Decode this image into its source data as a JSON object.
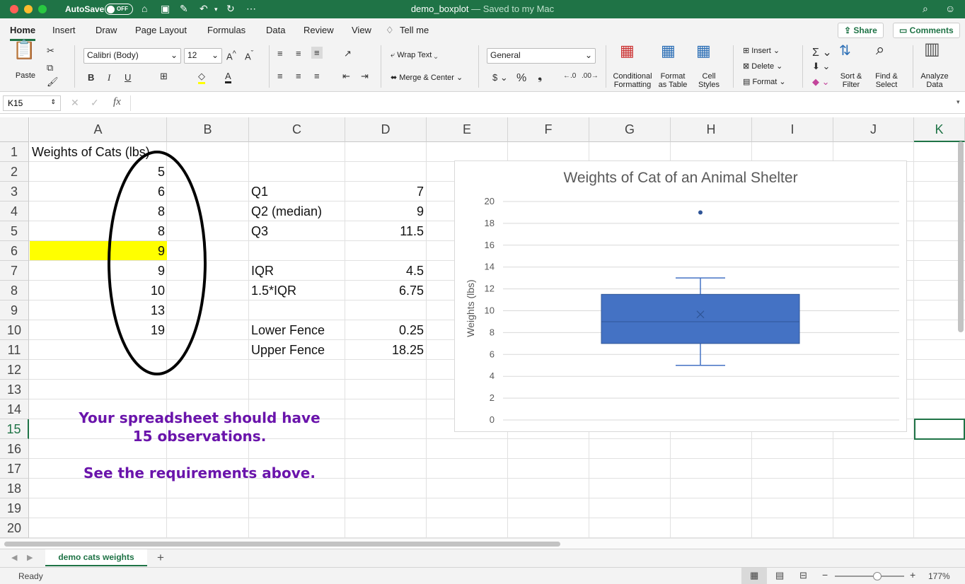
{
  "window": {
    "autosave_label": "AutoSave",
    "autosave_state": "OFF",
    "doc_title": "demo_boxplot",
    "doc_subtitle": "— Saved to my Mac"
  },
  "ribbon_tabs": [
    "Home",
    "Insert",
    "Draw",
    "Page Layout",
    "Formulas",
    "Data",
    "Review",
    "View",
    "Tell me"
  ],
  "header_buttons": {
    "share": "Share",
    "comments": "Comments"
  },
  "ribbon": {
    "paste": "Paste",
    "font_name": "Calibri (Body)",
    "font_size": "12",
    "bold": "B",
    "italic": "I",
    "underline": "U",
    "wrap_text": "Wrap Text",
    "merge_center": "Merge & Center",
    "number_format": "General",
    "conditional_formatting": [
      "Conditional",
      "Formatting"
    ],
    "format_as_table": [
      "Format",
      "as Table"
    ],
    "cell_styles": [
      "Cell",
      "Styles"
    ],
    "insert": "Insert",
    "delete": "Delete",
    "format": "Format",
    "sort_filter": [
      "Sort &",
      "Filter"
    ],
    "find_select": [
      "Find &",
      "Select"
    ],
    "analyze_data": [
      "Analyze",
      "Data"
    ]
  },
  "formula_bar": {
    "name_box": "K15",
    "fx": "fx",
    "formula": ""
  },
  "columns": [
    "A",
    "B",
    "C",
    "D",
    "E",
    "F",
    "G",
    "H",
    "I",
    "J",
    "K"
  ],
  "rows": [
    "1",
    "2",
    "3",
    "4",
    "5",
    "6",
    "7",
    "8",
    "9",
    "10",
    "11",
    "12",
    "13",
    "14",
    "15",
    "16",
    "17",
    "18",
    "19",
    "20"
  ],
  "cells": {
    "A1": "Weights of Cats (lbs)",
    "A2": "5",
    "A3": "6",
    "A4": "8",
    "A5": "8",
    "A6": "9",
    "A7": "9",
    "A8": "10",
    "A9": "13",
    "A10": "19",
    "C3": "Q1",
    "D3": "7",
    "C4": "Q2 (median)",
    "D4": "9",
    "C5": "Q3",
    "D5": "11.5",
    "C7": "IQR",
    "D7": "4.5",
    "C8": "1.5*IQR",
    "D8": "6.75",
    "C10": "Lower Fence",
    "D10": "0.25",
    "C11": "Upper Fence",
    "D11": "18.25"
  },
  "highlight_color": "#ffff00",
  "note": {
    "line1": "Your spreadsheet should have",
    "line2": "15 observations.",
    "line3": "See the requirements above."
  },
  "chart_data": {
    "type": "boxplot",
    "title": "Weights of Cat of an Animal Shelter",
    "ylabel": "Weights (lbs)",
    "xlabel": "",
    "ylim": [
      0,
      20
    ],
    "yticks": [
      "0",
      "2",
      "4",
      "6",
      "8",
      "10",
      "12",
      "14",
      "16",
      "18",
      "20"
    ],
    "grid": true,
    "box": {
      "min": 5,
      "q1": 7,
      "median": 9,
      "mean": 9.6667,
      "q3": 11.5,
      "max": 13,
      "outliers": [
        19
      ]
    },
    "color": "#4472c4"
  },
  "sheet_tabs": [
    "demo cats weights"
  ],
  "status": {
    "mode": "Ready",
    "zoom": "177%"
  }
}
